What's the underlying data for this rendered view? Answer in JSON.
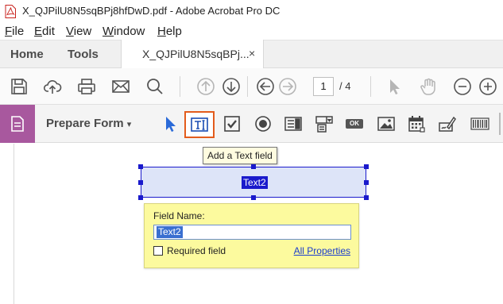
{
  "window": {
    "title": "X_QJPilU8N5sqBPj8hfDwD.pdf - Adobe Acrobat Pro DC"
  },
  "menu": {
    "items": [
      {
        "rest": "ile",
        "accel": "F"
      },
      {
        "rest": "dit",
        "accel": "E"
      },
      {
        "rest": "iew",
        "accel": "V"
      },
      {
        "rest": "indow",
        "accel": "W"
      },
      {
        "rest": "elp",
        "accel": "H"
      }
    ]
  },
  "tabs": {
    "home": "Home",
    "tools": "Tools",
    "document": "X_QJPilU8N5sqBPj...",
    "close": "×"
  },
  "toolbar": {
    "page_current": "1",
    "page_total": "/ 4",
    "icons": [
      "save-icon",
      "upload-icon",
      "print-icon",
      "email-icon",
      "search-icon",
      "page-up-icon",
      "page-down-icon",
      "back-icon",
      "forward-icon",
      "select-cursor-icon",
      "hand-icon",
      "zoom-out-icon",
      "zoom-in-icon"
    ]
  },
  "form_toolbar": {
    "title": "Prepare Form",
    "dropdown_arrow": "▾",
    "icons": [
      "select-object-icon",
      "text-field-icon",
      "checkbox-icon",
      "radio-button-icon",
      "list-box-icon",
      "dropdown-icon",
      "button-icon",
      "image-icon",
      "date-icon",
      "signature-icon",
      "barcode-icon"
    ],
    "button_text": "OK"
  },
  "tooltip": {
    "text": "Add a Text field"
  },
  "field": {
    "name": "Text2"
  },
  "popup": {
    "label": "Field Name:",
    "value": "Text2",
    "required_label": "Required field",
    "required_checked": false,
    "all_properties": "All Properties"
  },
  "colors": {
    "accent_purple": "#a8589e",
    "selection_orange": "#e35c1c",
    "field_blue": "#1a1acc",
    "popup_yellow": "#fcfa9e"
  }
}
